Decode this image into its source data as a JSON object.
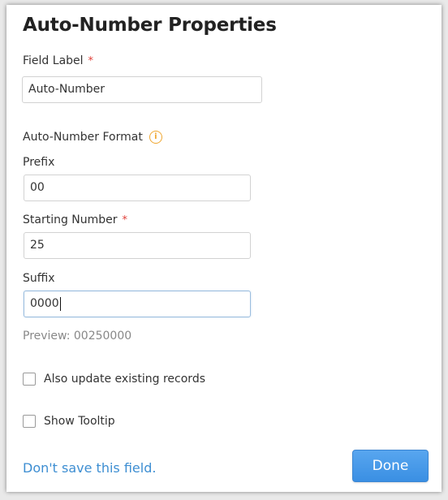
{
  "dialog": {
    "title": "Auto-Number Properties",
    "field_label": {
      "label": "Field Label",
      "required_mark": "*",
      "value": "Auto-Number"
    },
    "format_section": {
      "heading": "Auto-Number Format",
      "info_icon": "i"
    },
    "prefix": {
      "label": "Prefix",
      "value": "00"
    },
    "starting_number": {
      "label": "Starting Number",
      "required_mark": "*",
      "value": "25"
    },
    "suffix": {
      "label": "Suffix",
      "value": "0000"
    },
    "preview": "Preview: 00250000",
    "checkboxes": [
      {
        "label": "Also update existing records",
        "checked": false
      },
      {
        "label": "Show Tooltip",
        "checked": false
      }
    ],
    "dont_save_label": "Don't save this field.",
    "done_label": "Done"
  },
  "colors": {
    "accent": "#3a8fe3",
    "link": "#3d8ed2",
    "required": "#e0413a",
    "info": "#f0a732"
  }
}
